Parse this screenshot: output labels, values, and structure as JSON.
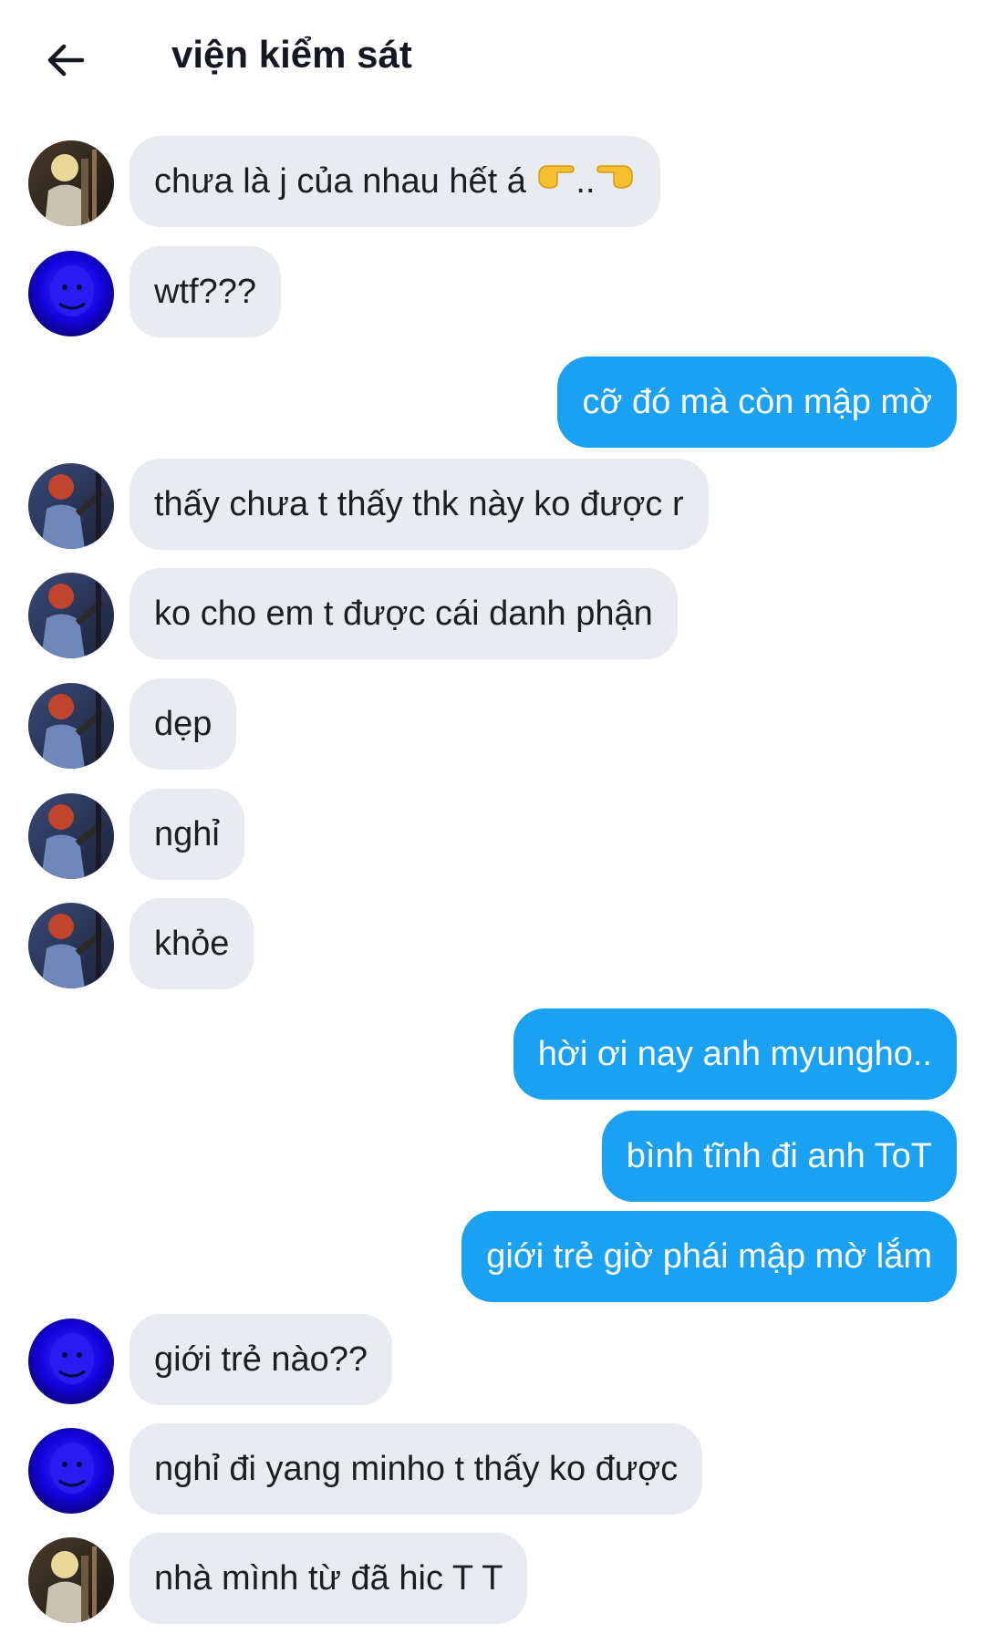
{
  "header": {
    "title": "viện kiểm sát",
    "back_icon": "arrow-left-icon"
  },
  "colors": {
    "incoming_bubble": "#e8ebef",
    "outgoing_bubble": "#1ba1f2",
    "text_dark": "#1c1e21"
  },
  "messages": [
    {
      "side": "in",
      "avatar": "avatar-guitar-blonde",
      "text": "chưa là j của nhau hết á",
      "tail": "..",
      "emoji": "pointing-hands-emoji"
    },
    {
      "side": "in",
      "avatar": "avatar-blue",
      "text": "wtf???"
    },
    {
      "side": "out",
      "text": "cỡ đó mà còn mập mờ"
    },
    {
      "side": "in",
      "avatar": "avatar-guitar-red",
      "text": "thấy chưa t thấy thk này ko được r"
    },
    {
      "side": "in",
      "avatar": "avatar-guitar-red",
      "text": "ko cho em t được cái danh phận"
    },
    {
      "side": "in",
      "avatar": "avatar-guitar-red",
      "text": "dẹp"
    },
    {
      "side": "in",
      "avatar": "avatar-guitar-red",
      "text": "nghỉ"
    },
    {
      "side": "in",
      "avatar": "avatar-guitar-red",
      "text": "khỏe"
    },
    {
      "side": "out",
      "text": "hời ơi nay anh myungho.."
    },
    {
      "side": "out",
      "text": "bình tĩnh đi anh ToT"
    },
    {
      "side": "out",
      "text": "giới trẻ giờ phái mập mờ lắm"
    },
    {
      "side": "in",
      "avatar": "avatar-blue",
      "text": "giới trẻ nào??"
    },
    {
      "side": "in",
      "avatar": "avatar-blue",
      "text": "nghỉ đi yang minho t thấy ko được"
    },
    {
      "side": "in",
      "avatar": "avatar-guitar-blonde",
      "text": "nhà mình từ đã hic T T"
    }
  ]
}
